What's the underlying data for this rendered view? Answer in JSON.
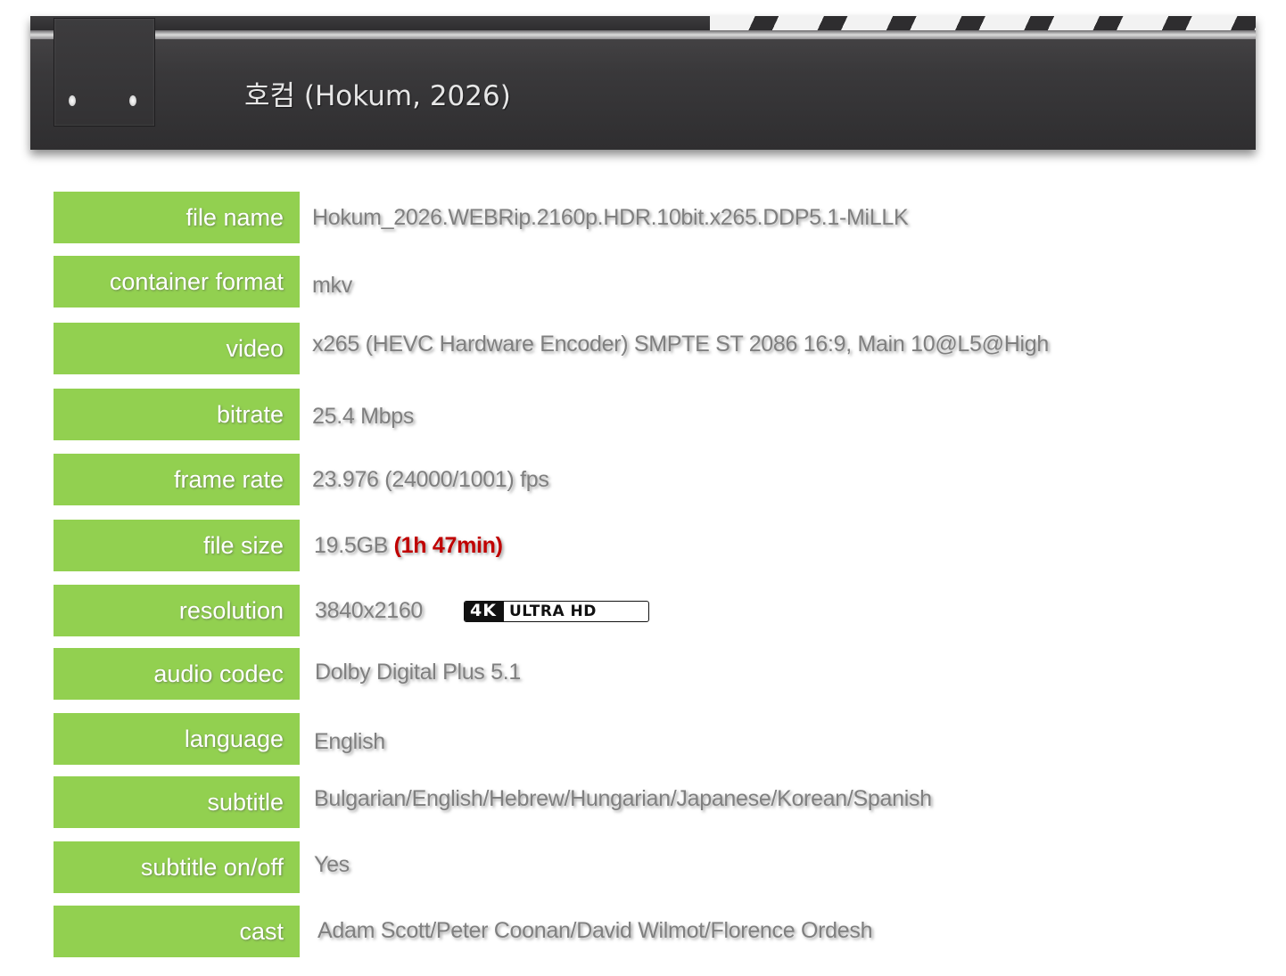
{
  "header": {
    "title": "호컴 (Hokum, 2026)"
  },
  "rows": [
    {
      "label": "file name",
      "value": "Hokum_2026.WEBRip.2160p.HDR.10bit.x265.DDP5.1-MiLLK"
    },
    {
      "label": "container format",
      "value": "mkv"
    },
    {
      "label": "video",
      "value": "x265 (HEVC Hardware Encoder) SMPTE ST 2086 16:9, Main 10@L5@High"
    },
    {
      "label": "bitrate",
      "value": "25.4 Mbps"
    },
    {
      "label": "frame rate",
      "value": "23.976 (24000/1001) fps"
    },
    {
      "label": "file size",
      "value": "19.5GB",
      "extra": "(1h 47min)"
    },
    {
      "label": "resolution",
      "value": "3840x2160",
      "badge_left": "4K",
      "badge_right": "ULTRA HD"
    },
    {
      "label": "audio codec",
      "value": "Dolby Digital Plus 5.1"
    },
    {
      "label": "language",
      "value": "English"
    },
    {
      "label": "subtitle",
      "value": "Bulgarian/English/Hebrew/Hungarian/Japanese/Korean/Spanish"
    },
    {
      "label": "subtitle on/off",
      "value": "Yes"
    },
    {
      "label": "cast",
      "value": "Adam Scott/Peter Coonan/David Wilmot/Florence Ordesh"
    }
  ],
  "colors": {
    "label_bg": "#92d050",
    "value_text": "#7f7f7f",
    "runtime_text": "#c00000",
    "header_bg": "#3a393b"
  }
}
